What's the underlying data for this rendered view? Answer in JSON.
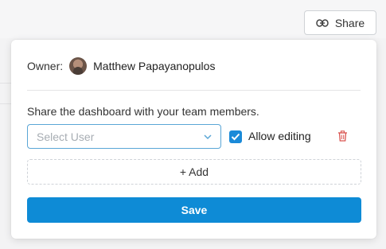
{
  "header": {
    "share_label": "Share"
  },
  "owner": {
    "label": "Owner:",
    "name": "Matthew Papayanopulos"
  },
  "share": {
    "instructions": "Share the dashboard with your team members.",
    "select_placeholder": "Select User",
    "allow_editing_label": "Allow editing",
    "allow_editing_checked": true,
    "add_label": "+ Add",
    "save_label": "Save"
  },
  "colors": {
    "accent": "#0e8bd6",
    "checkbox": "#1a8ad8",
    "delete": "#d9534f",
    "select_border": "#5aa6d6"
  },
  "icons": {
    "share": "link-icon",
    "dropdown": "chevron-down-icon",
    "delete": "trash-icon",
    "checkbox": "check-icon"
  }
}
